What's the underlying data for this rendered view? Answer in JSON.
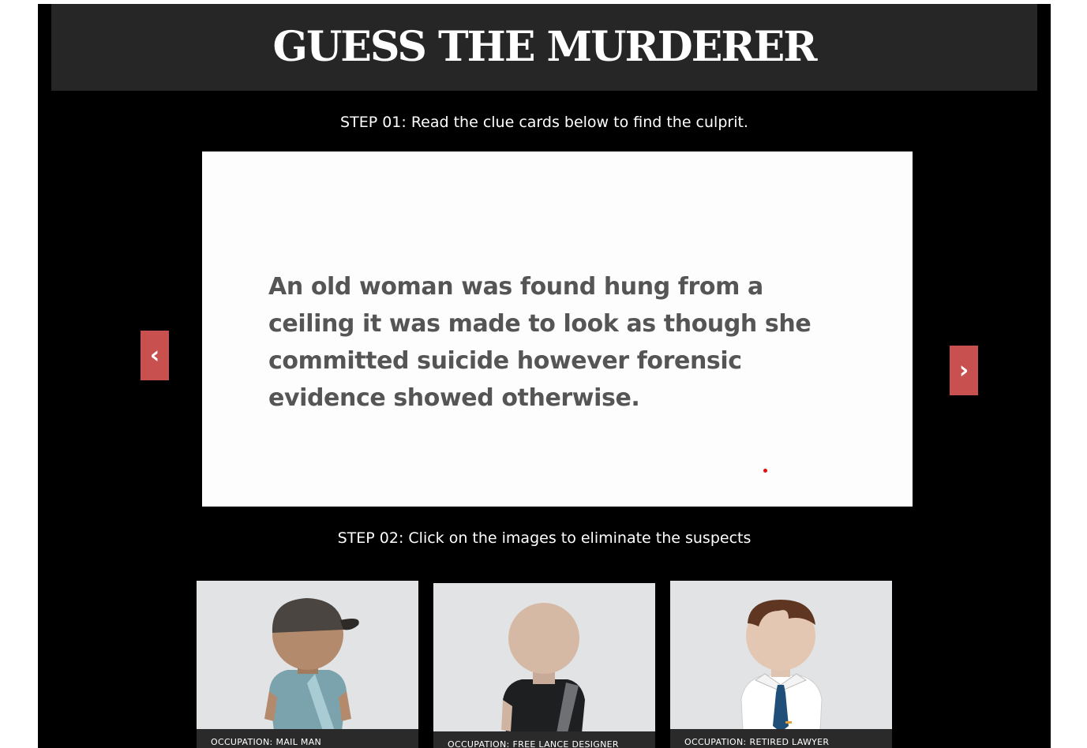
{
  "header": {
    "title": "GUESS THE MURDERER"
  },
  "steps": {
    "step1": "STEP 01: Read the clue cards below to find the culprit.",
    "step2": "STEP 02: Click on the images to eliminate the suspects"
  },
  "carousel": {
    "clue_text": "An old woman was found hung from a ceiling it was made to look as though she committed suicide however forensic evidence showed otherwise.",
    "prev_label": "‹",
    "next_label": "›"
  },
  "suspects": [
    {
      "occupation_label": "OCCUPATION:",
      "occupation": "MAIL MAN",
      "icon": "mail-man-avatar"
    },
    {
      "occupation_label": "OCCUPATION:",
      "occupation": "FREE LANCE DESIGNER",
      "icon": "designer-avatar"
    },
    {
      "occupation_label": "OCCUPATION:",
      "occupation": "RETIRED LAWYER",
      "icon": "lawyer-avatar"
    }
  ],
  "colors": {
    "background": "#000000",
    "header_bg": "#262626",
    "nav_button": "#c8504f",
    "card_bg": "#e2e3e5"
  }
}
